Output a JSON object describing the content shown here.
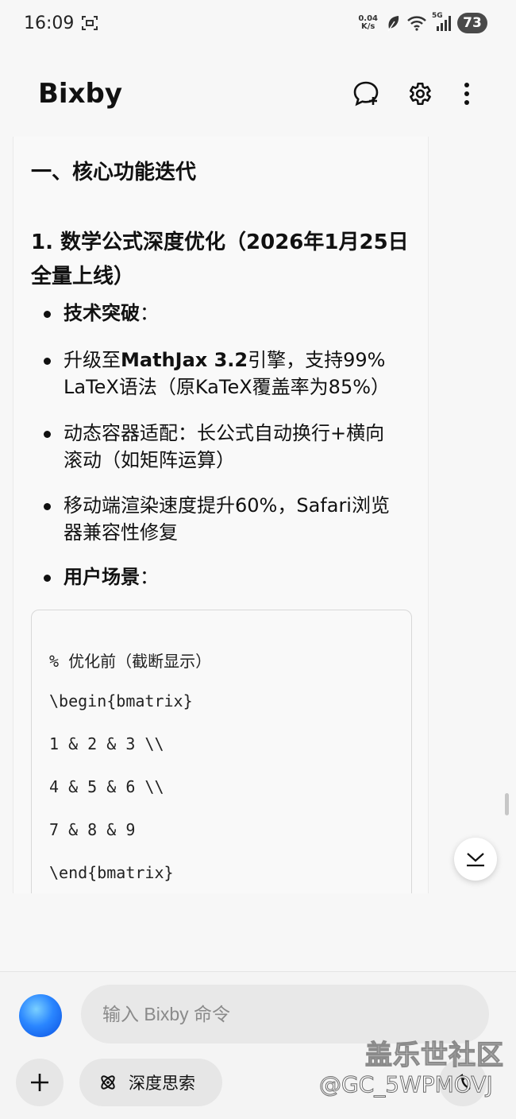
{
  "status_bar": {
    "time": "16:09",
    "net_speed_value": "0.04",
    "net_speed_unit": "K/s",
    "network": "5G",
    "battery": "73"
  },
  "header": {
    "title": "Bixby",
    "icons": [
      "new-chat-icon",
      "gear-icon",
      "more-vertical-icon"
    ]
  },
  "content": {
    "section_heading": "一、核心功能迭代",
    "subheading": "1. 数学公式深度优化（2026年1月25日全量上线）",
    "bullets": [
      {
        "bold": "技术突破",
        "text": "："
      },
      {
        "pre": "升级至",
        "bold": "MathJax 3.2",
        "text": "引擎，支持99% LaTeX语法（原KaTeX覆盖率为85%）"
      },
      {
        "text": "动态容器适配：长公式自动换行+横向滚动（如矩阵运算）"
      },
      {
        "text": "移动端渲染速度提升60%，Safari浏览器兼容性修复"
      },
      {
        "bold": "用户场景",
        "text": "："
      }
    ],
    "code_lines": [
      "% 优化前（截断显示）",
      "\\begin{bmatrix}",
      "1 & 2 & 3 \\\\",
      "4 & 5 & 6 \\\\",
      "7 & 8 & 9",
      "\\end{bmatrix}"
    ]
  },
  "bottom_bar": {
    "input_placeholder": "输入 Bixby 命令",
    "deep_think_label": "深度思索"
  },
  "watermark": {
    "site": "盖乐世社区",
    "user": "@GC_5WPMOVJ"
  },
  "colors": {
    "background": "#f7f7f7",
    "accent_blue": "#2a86ff",
    "text": "#111111"
  }
}
